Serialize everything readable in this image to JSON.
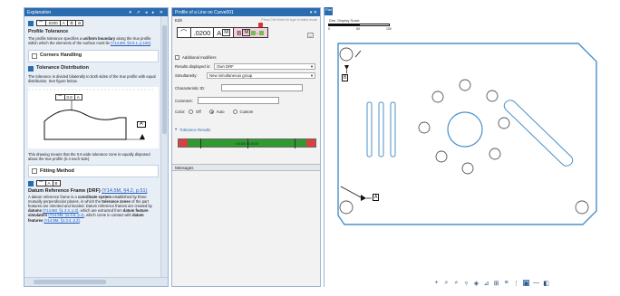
{
  "explanation": {
    "title": "Explanation",
    "title_controls": "▾ ↗ ◂ ▸ ✕",
    "top_fcf": {
      "symbol": "⌒",
      "value": ".0200",
      "mod1": "A",
      "mod2": "Ⓜ",
      "ref": "B"
    },
    "profile_tolerance": {
      "heading": "Profile Tolerance",
      "text_1": "The profile tolerance specifies a ",
      "bold_1": "uniform boundary",
      "text_2": " along the true profile within which the elements of the surface must lie ",
      "link": "(Y14.5M, §6.5.1, p.163)",
      "text_3": "."
    },
    "corners_handling": "Corners Handling",
    "tolerance_distribution": {
      "heading": "Tolerance Distribution",
      "text": "The tolerance is divided bilaterally to both sides of the true profile with equal distribution. See figure below.",
      "fcf": {
        "symbol": "⌒",
        "value": "0.8",
        "ref": "A"
      },
      "datum_label": "A",
      "caption": "This drawing means that the 0.8 wide tolerance zone is equally disposed about the true profile (0.4 each side)."
    },
    "fitting_method": "Fitting Method",
    "drf_fcf": {
      "symbol": "⌒",
      "a": "A",
      "b": "B"
    },
    "drf": {
      "heading": "Datum Reference Frame (DRF)",
      "link": "(Y14.5M, §4.2, p.51)",
      "text_1": "A datum reference frame is a ",
      "bold_1": "coordinate system",
      "text_2": " established by three mutually perpendicular planes, in which the ",
      "bold_2": "tolerance zones",
      "text_3": " of the part features are oriented and located. Datum reference frames are created by ",
      "bold_3": "datums",
      "link_2": "(Y14.5M, §1.3.3, p.2)",
      "text_4": ", which are extracted from ",
      "bold_4": "datum feature simulators",
      "link_3": "(Y14.5M, §1.3.5, p.3)",
      "text_5": ", which come in contact with ",
      "bold_5": "datum features",
      "link_4": "(Y14.5M, §1.3.4, p.2)",
      "text_6": "."
    }
  },
  "profile": {
    "title": "Profile of a Line on Curve001",
    "title_controls": "▾ ✕",
    "edit_label": "Edit",
    "edit_hint": "Press Ctrl+Enter for type in editor mode",
    "fcf": {
      "symbol": "⌒",
      "value": ".0200",
      "ref_a": "A",
      "mod_a": "M",
      "ref_b": "B",
      "mod_b": "M"
    },
    "button_minus": "–",
    "additional_modifiers": "Additional modifiers",
    "results_displayed_in_label": "Results displayed in:",
    "results_displayed_in_value": "Own DRF",
    "simultaneity_label": "Simultaneity:",
    "simultaneity_value": "New simultaneous group",
    "characteristic_id_label": "Characteristic ID:",
    "characteristic_id_value": "",
    "comment_label": "Comment:",
    "comment_value": "",
    "color_label": "Color:",
    "color_options": [
      "Off",
      "Auto",
      "Custom"
    ],
    "color_selected": "Auto",
    "tolerance_results": "Tolerance Results",
    "tol_bar_label": "0.0100 ±0.0100",
    "messages": "Messages"
  },
  "cad": {
    "tab_label": "Flat",
    "scale_label": "Dim. Display Scale",
    "scale_0": "0",
    "scale_mid": "50",
    "scale_end": "100",
    "datum_b": "B",
    "datum_a": "A",
    "toolbar_icons": [
      "plus-icon",
      "zoom-icon",
      "zoom-in-icon",
      "filter-icon",
      "view-icon",
      "ruler-icon",
      "grid-icon",
      "align-icon",
      "hierarchy-icon",
      "frame-icon",
      "line-icon",
      "cube-icon"
    ],
    "colors": {
      "part_outline": "#4a90c8",
      "datum_triangle": "#111111"
    }
  }
}
